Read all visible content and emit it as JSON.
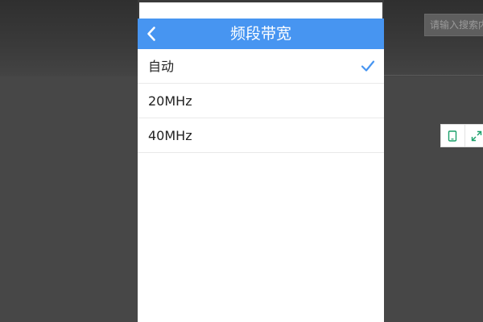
{
  "background": {
    "search_placeholder": "请输入搜索内容",
    "tools": [
      {
        "icon": "tablet-icon"
      },
      {
        "icon": "expand-icon"
      }
    ]
  },
  "header": {
    "title": "频段带宽",
    "back_icon": "chevron-left-icon",
    "color": "#4795f1"
  },
  "options": [
    {
      "label": "自动",
      "selected": true
    },
    {
      "label": "20MHz",
      "selected": false
    },
    {
      "label": "40MHz",
      "selected": false
    }
  ],
  "check_icon": "checkmark-icon",
  "check_color": "#4795f1"
}
